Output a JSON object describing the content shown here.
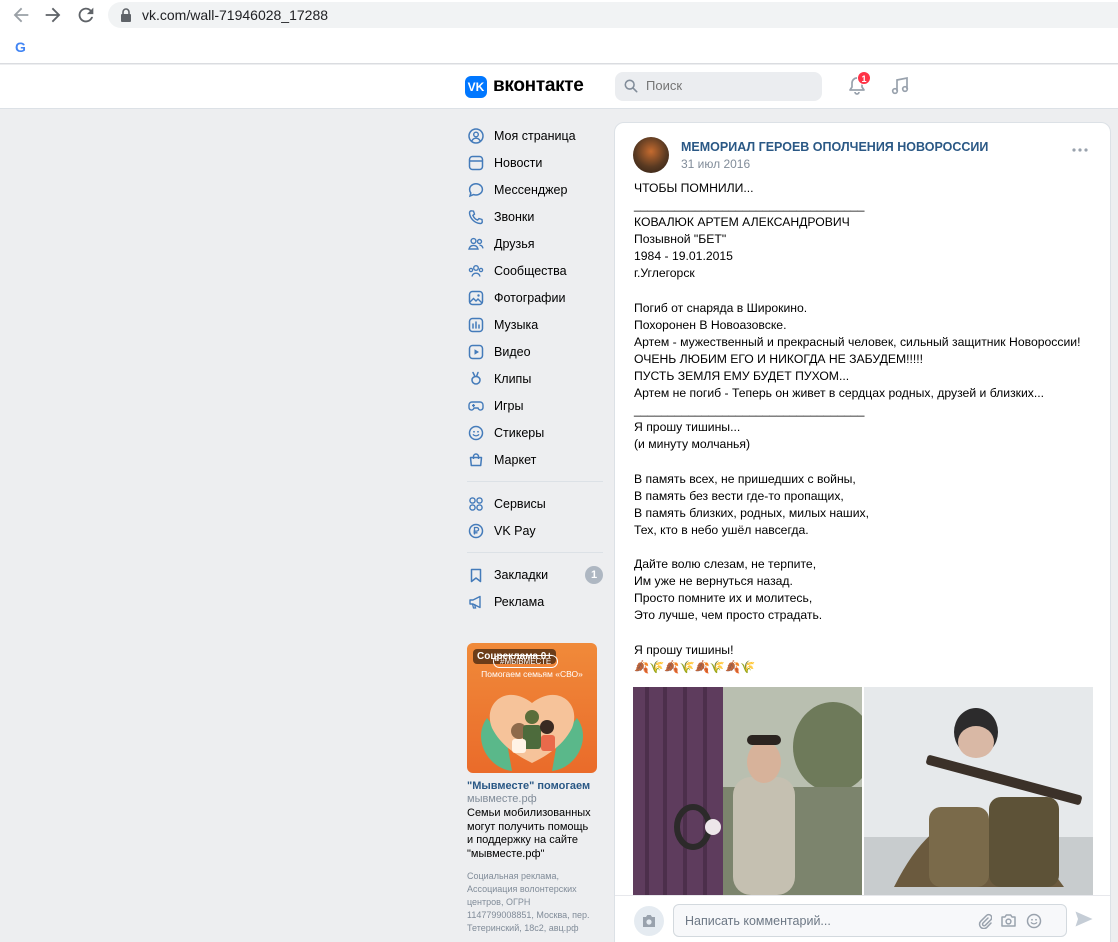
{
  "browser": {
    "url": "vk.com/wall-71946028_17288",
    "bookmark_logo": "G"
  },
  "header": {
    "logo_mark": "VK",
    "logo_text": "вконтакте",
    "search_placeholder": "Поиск",
    "notifications_count": "1"
  },
  "menu": {
    "items": [
      {
        "label": "Моя страница",
        "icon": "user-circle-icon"
      },
      {
        "label": "Новости",
        "icon": "news-icon"
      },
      {
        "label": "Мессенджер",
        "icon": "message-icon"
      },
      {
        "label": "Звонки",
        "icon": "phone-icon"
      },
      {
        "label": "Друзья",
        "icon": "friends-icon"
      },
      {
        "label": "Сообщества",
        "icon": "communities-icon"
      },
      {
        "label": "Фотографии",
        "icon": "photo-icon"
      },
      {
        "label": "Музыка",
        "icon": "music-icon"
      },
      {
        "label": "Видео",
        "icon": "video-icon"
      },
      {
        "label": "Клипы",
        "icon": "clips-icon"
      },
      {
        "label": "Игры",
        "icon": "games-icon"
      },
      {
        "label": "Стикеры",
        "icon": "stickers-icon"
      },
      {
        "label": "Маркет",
        "icon": "market-icon"
      }
    ],
    "services": [
      {
        "label": "Сервисы",
        "icon": "services-icon"
      },
      {
        "label": "VK Pay",
        "icon": "vkpay-icon"
      }
    ],
    "bottom": [
      {
        "label": "Закладки",
        "icon": "bookmark-icon",
        "count": "1"
      },
      {
        "label": "Реклама",
        "icon": "megaphone-icon"
      }
    ]
  },
  "ad": {
    "badge": "Соцреклама 0+",
    "pill": "#МЫВМЕСТЕ",
    "subtitle": "Помогаем семьям «СВО»",
    "title": "\"Мывместе\" помогаем",
    "domain": "мывместе.рф",
    "description": "Семьи мобилизованных могут получить помощь и поддержку на сайте \"мывместе.рф\"",
    "legal": "Социальная реклама, Ассоциация волонтерских центров, ОГРН 1147799008851, Москва, пер. Тетеринский, 18с2, авц.рф"
  },
  "post": {
    "author": "МЕМОРИАЛ ГЕРОЕВ ОПОЛЧЕНИЯ НОВОРОССИИ",
    "date": "31 июл 2016",
    "text": "ЧТОБЫ ПОМНИЛИ...\n__________________________________\nКОВАЛЮК АРТЕМ АЛЕКСАНДРОВИЧ\nПозывной \"БЕТ\"\n1984 - 19.01.2015\nг.Углегорск\n\nПогиб от снаряда в Широкино.\nПохоронен В Новоазовске.\nАртем - мужественный и прекрасный человек, сильный защитник Новороссии!\nОЧЕНЬ ЛЮБИМ ЕГО И НИКОГДА НЕ ЗАБУДЕМ!!!!!\nПУСТЬ ЗЕМЛЯ ЕМУ БУДЕТ ПУХОМ...\nАртем не погиб - Теперь он живет в сердцах родных, друзей и близких...\n__________________________________\nЯ прошу тишины...\n(и минуту молчанья)\n\nВ память всех, не пришедших с войны,\nВ память без вести где-то пропащих,\nВ память близких, родных, милых наших,\nТех, кто в небо ушёл навсегда.\n\nДайте волю слезам, не терпите,\nИм уже не вернуться назад.\nПросто помните их и молитесь,\nЭто лучше, чем просто страдать.\n\nЯ прошу тишины!\n🍂🌾🍂🌾🍂🌾🍂🌾",
    "comment_placeholder": "Написать комментарий..."
  },
  "colors": {
    "vk_blue": "#0077ff",
    "link": "#2a5885",
    "badge_red": "#ff3347",
    "bg": "#edeef0"
  }
}
